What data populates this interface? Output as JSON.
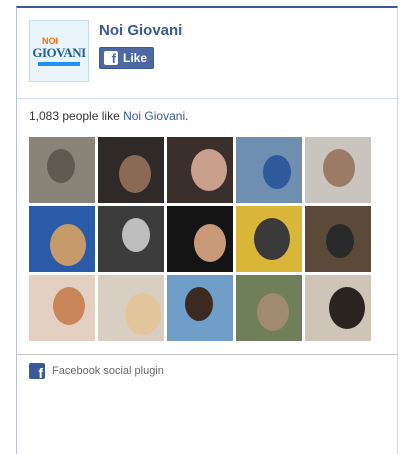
{
  "page": {
    "name": "Noi Giovani",
    "logo_text_top": "NOI",
    "logo_text_main": "GIOVANI"
  },
  "like_button": {
    "label": "Like"
  },
  "likes": {
    "count_text": "1,083 people like ",
    "page_link": "Noi Giovani",
    "suffix": "."
  },
  "fans": [
    {
      "bg": "#8a8478",
      "fg": "#5f5a50"
    },
    {
      "bg": "#2f2a28",
      "fg": "#8b6a55"
    },
    {
      "bg": "#3a2f2a",
      "fg": "#c8a08c"
    },
    {
      "bg": "#6f8fb0",
      "fg": "#2e5a9c"
    },
    {
      "bg": "#c9c4bd",
      "fg": "#9b7b66"
    },
    {
      "bg": "#2b5aa8",
      "fg": "#c79a6a"
    },
    {
      "bg": "#3c3c3c",
      "fg": "#bdbdbd"
    },
    {
      "bg": "#141414",
      "fg": "#c99a7a"
    },
    {
      "bg": "#d9b638",
      "fg": "#3a3a3a"
    },
    {
      "bg": "#5b4a3a",
      "fg": "#2a2a2a"
    },
    {
      "bg": "#e4cfc3",
      "fg": "#c9865a"
    },
    {
      "bg": "#d8cfc2",
      "fg": "#e2c59a"
    },
    {
      "bg": "#6f9fc9",
      "fg": "#3a2a22"
    },
    {
      "bg": "#6f7f5a",
      "fg": "#a08a70"
    },
    {
      "bg": "#cfc4b8",
      "fg": "#2b2320"
    }
  ],
  "footer": {
    "label": "Facebook social plugin"
  }
}
